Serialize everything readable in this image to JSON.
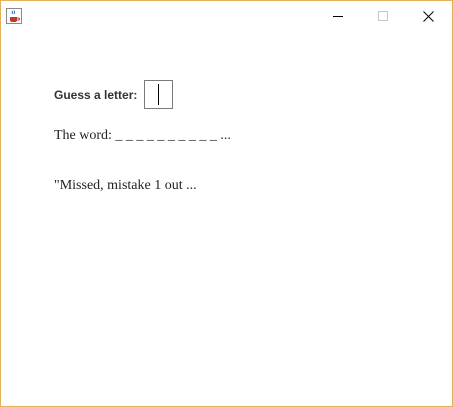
{
  "window": {
    "icon": "java-coffee-cup-icon",
    "controls": {
      "minimize_icon": "minimize-icon",
      "maximize_icon": "maximize-icon",
      "close_icon": "close-icon"
    },
    "border_color": "#e3b15a"
  },
  "form": {
    "guess_label": "Guess a letter:",
    "guess_value": ""
  },
  "game": {
    "word_text": "The word: _ _ _ _ _ _ _ _ _ _ ...",
    "status_text": "\"Missed, mistake 1 out ..."
  }
}
